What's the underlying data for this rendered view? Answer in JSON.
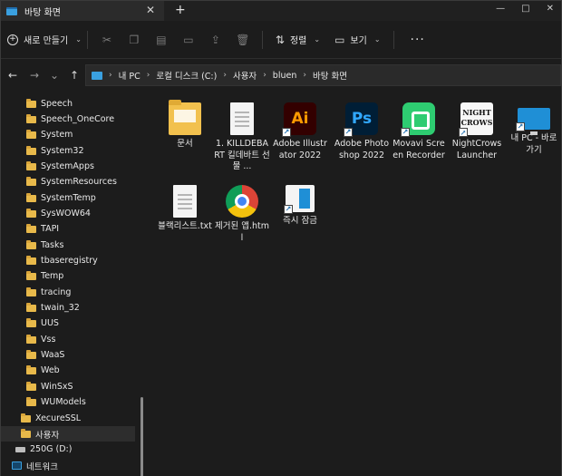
{
  "window": {
    "tab_title": "바탕 화면",
    "tab_close": "✕",
    "new_tab": "+",
    "minimize": "—",
    "maximize": "□",
    "close": "✕"
  },
  "commandbar": {
    "new_label": "새로 만들기",
    "sort_label": "정렬",
    "view_label": "보기",
    "more_label": "···",
    "icons": [
      "cut-icon",
      "copy-icon",
      "paste-icon",
      "rename-icon",
      "share-icon",
      "delete-icon"
    ]
  },
  "nav": {
    "back": "←",
    "forward": "→",
    "dropdown": "⌄",
    "up": "↑"
  },
  "breadcrumb": [
    "내 PC",
    "로컬 디스크 (C:)",
    "사용자",
    "bluen",
    "바탕 화면"
  ],
  "breadcrumb_sep": "›",
  "sidebar": {
    "items": [
      {
        "label": "Speech",
        "type": "folder"
      },
      {
        "label": "Speech_OneCore",
        "type": "folder"
      },
      {
        "label": "System",
        "type": "folder"
      },
      {
        "label": "System32",
        "type": "folder"
      },
      {
        "label": "SystemApps",
        "type": "folder"
      },
      {
        "label": "SystemResources",
        "type": "folder"
      },
      {
        "label": "SystemTemp",
        "type": "folder"
      },
      {
        "label": "SysWOW64",
        "type": "folder"
      },
      {
        "label": "TAPI",
        "type": "folder"
      },
      {
        "label": "Tasks",
        "type": "folder"
      },
      {
        "label": "tbaseregistry",
        "type": "folder"
      },
      {
        "label": "Temp",
        "type": "folder"
      },
      {
        "label": "tracing",
        "type": "folder"
      },
      {
        "label": "twain_32",
        "type": "folder"
      },
      {
        "label": "UUS",
        "type": "folder"
      },
      {
        "label": "Vss",
        "type": "folder"
      },
      {
        "label": "WaaS",
        "type": "folder"
      },
      {
        "label": "Web",
        "type": "folder"
      },
      {
        "label": "WinSxS",
        "type": "folder"
      },
      {
        "label": "WUModels",
        "type": "folder"
      },
      {
        "label": "XecureSSL",
        "type": "folder"
      },
      {
        "label": "사용자",
        "type": "folder"
      },
      {
        "label": "250G (D:)",
        "type": "drive"
      },
      {
        "label": "네트워크",
        "type": "network"
      }
    ]
  },
  "files": [
    {
      "label": "문서",
      "icon": "folder-icon"
    },
    {
      "label": "1. KILLDEBART 킬데바트 선물 ...",
      "icon": "text-document-icon"
    },
    {
      "label": "Adobe Illustrator 2022",
      "icon": "adobe-illustrator-icon",
      "glyph": "Ai",
      "shortcut": true
    },
    {
      "label": "Adobe Photoshop 2022",
      "icon": "adobe-photoshop-icon",
      "glyph": "Ps",
      "shortcut": true
    },
    {
      "label": "Movavi Screen Recorder",
      "icon": "movavi-recorder-icon",
      "shortcut": true
    },
    {
      "label": "NightCrows Launcher",
      "icon": "nightcrows-icon",
      "glyph": "NIGHT CROWS",
      "shortcut": true
    },
    {
      "label": "내 PC - 바로 가기",
      "icon": "pc-monitor-icon",
      "shortcut": true
    },
    {
      "label": "블랙리스트.txt",
      "icon": "text-document-icon"
    },
    {
      "label": "제거된 앱.html",
      "icon": "chrome-icon"
    },
    {
      "label": "즉시 잠금",
      "icon": "task-window-icon",
      "shortcut": true
    }
  ],
  "shortcut_glyph": "↗"
}
